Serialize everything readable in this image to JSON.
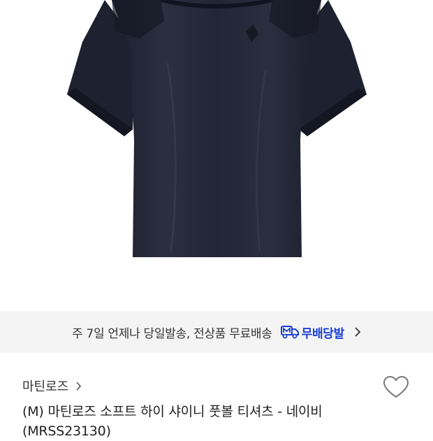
{
  "banner": {
    "text": "주 7일 언제나 당일발송, 전상품 무료배송",
    "badge_icon": "m-truck-icon",
    "badge_label": "무배당발",
    "accent": "#1a3fd6",
    "background": "#f4f4f4"
  },
  "product": {
    "brand": "마틴로즈",
    "title": "(M) 마틴로즈 소프트 하이 샤이니 풋볼 티셔츠 - 네이비 (MRSS23130)",
    "garment_color": "#232636"
  },
  "icons": {
    "brand_chevron": "chevron-right-icon",
    "banner_chevron": "chevron-right-icon",
    "like": "heart-outline-icon"
  }
}
